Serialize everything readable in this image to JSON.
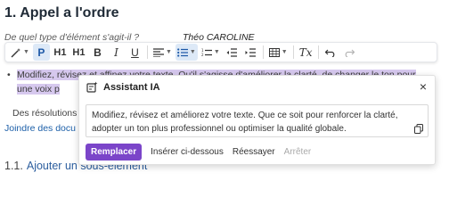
{
  "heading": "1. Appel a l'ordre",
  "question": {
    "label": "De quel type d'élément s'agit-il ?",
    "name": "Théo CAROLINE"
  },
  "toolbar": {
    "paragraph": "P",
    "h1": "H1",
    "h1_sub": "H1",
    "bold": "B",
    "italic": "I",
    "underline": "U",
    "clear_format": "Tx"
  },
  "bullet": {
    "highlighted": "Modifiez, révisez et affinez votre texte. Qu'il s'agisse d'améliorer la clarté, de changer le ton pour",
    "line2_start": "une voix p"
  },
  "resolutions_label": "Des résolutions",
  "link_label": "Joindre des docu",
  "subheading": {
    "num": "1.1.",
    "text": "Ajouter un sous-élément"
  },
  "dialog": {
    "title": "Assistant IA",
    "close": "×",
    "body": "Modifiez, révisez et améliorez votre texte. Que ce soit pour renforcer la clarté, adopter un ton plus professionnel ou optimiser la qualité globale.",
    "actions": {
      "replace": "Remplacer",
      "insert_below": "Insérer ci-dessous",
      "retry": "Réessayer",
      "stop": "Arrêter"
    }
  },
  "icons": [
    "magic-wand-icon",
    "text-align-icon",
    "bullet-list-icon",
    "numbered-list-icon",
    "outdent-icon",
    "indent-icon",
    "table-icon",
    "undo-icon",
    "redo-icon",
    "ai-assistant-icon",
    "copy-icon"
  ],
  "colors": {
    "accent": "#7b45c9",
    "link": "#1c5fa8",
    "highlight": "#d6c8ee",
    "active_tool": "#dde9f7"
  }
}
